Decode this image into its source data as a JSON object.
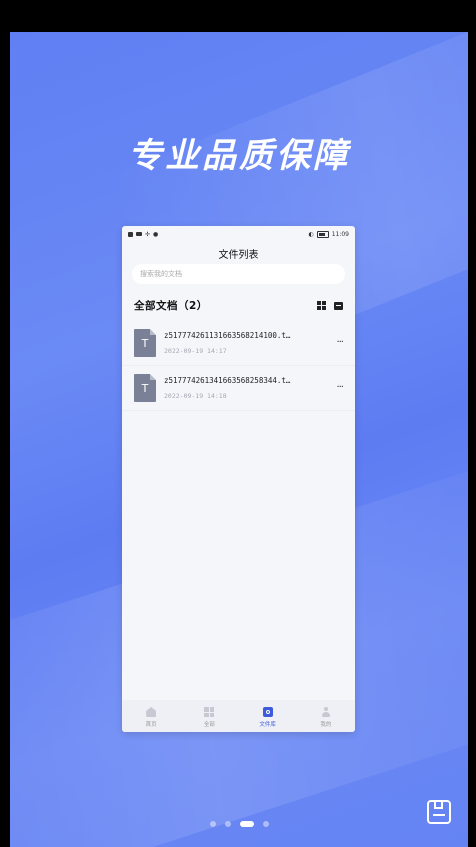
{
  "promo": {
    "headline": "专业品质保障"
  },
  "status_bar": {
    "time": "11:09",
    "left_icons": [
      "sim-icon",
      "signal-icon",
      "wifi-icon",
      "usb-icon",
      "notify-icon"
    ],
    "right_icons": [
      "vibrate-icon",
      "battery-icon"
    ]
  },
  "screen": {
    "title": "文件列表",
    "search_placeholder": "搜索我的文档",
    "section_title": "全部文档（2）"
  },
  "files": [
    {
      "name": "z5177742611316635682141​00.t…",
      "date": "2022-09-19 14:17",
      "icon_letter": "T"
    },
    {
      "name": "z5177742613416635682583​44.t…",
      "date": "2022-09-19 14:18",
      "icon_letter": "T"
    }
  ],
  "more_label": "···",
  "tabbar": {
    "items": [
      {
        "label": "首页",
        "icon": "home-icon",
        "active": false
      },
      {
        "label": "全部",
        "icon": "grid-icon",
        "active": false
      },
      {
        "label": "文件库",
        "icon": "library-icon",
        "active": true
      },
      {
        "label": "我的",
        "icon": "user-icon",
        "active": false
      }
    ]
  },
  "pager": {
    "count": 4,
    "active_index": 2
  },
  "colors": {
    "accent": "#3b5bdb",
    "background": "#6584f3"
  }
}
